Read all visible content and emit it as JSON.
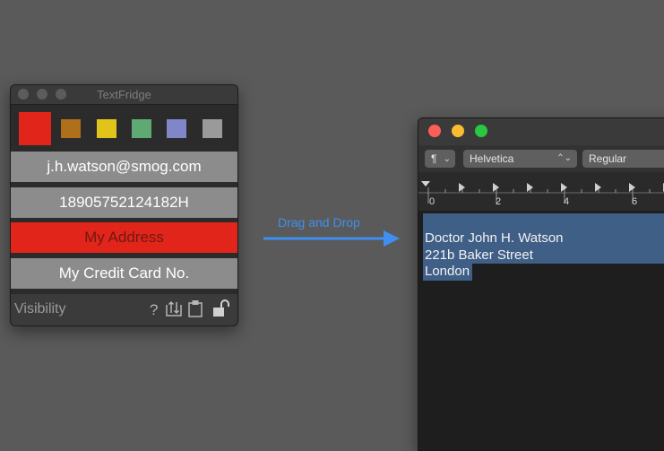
{
  "textfridge": {
    "title": "TextFridge",
    "swatches": [
      {
        "name": "red",
        "color": "#e2251a",
        "selected": true
      },
      {
        "name": "brown",
        "color": "#b06f1a",
        "selected": false
      },
      {
        "name": "yellow",
        "color": "#e1c41a",
        "selected": false
      },
      {
        "name": "green",
        "color": "#5faa73",
        "selected": false
      },
      {
        "name": "blue",
        "color": "#8086c8",
        "selected": false
      },
      {
        "name": "gray",
        "color": "#9a9a9a",
        "selected": false
      }
    ],
    "items": [
      {
        "label": "j.h.watson@smog.com",
        "active": false
      },
      {
        "label": "18905752124182H",
        "active": false
      },
      {
        "label": "My Address",
        "active": true
      },
      {
        "label": "My Credit Card No.",
        "active": false
      }
    ],
    "footer": {
      "visibility_label": "Visibility",
      "help_glyph": "?",
      "icons": [
        "sort-icon",
        "clipboard-icon",
        "unlock-icon"
      ]
    }
  },
  "drag_and_drop": {
    "label": "Drag and Drop",
    "color": "#3f8ff0"
  },
  "editor": {
    "toolbar": {
      "paragraph_glyph": "¶",
      "font_family": "Helvetica",
      "font_style": "Regular"
    },
    "ruler_numbers": [
      "0",
      "2",
      "4",
      "6"
    ],
    "lines": [
      "Doctor John H. Watson",
      "221b Baker Street",
      "London"
    ],
    "selection_color": "#3f5f87"
  }
}
